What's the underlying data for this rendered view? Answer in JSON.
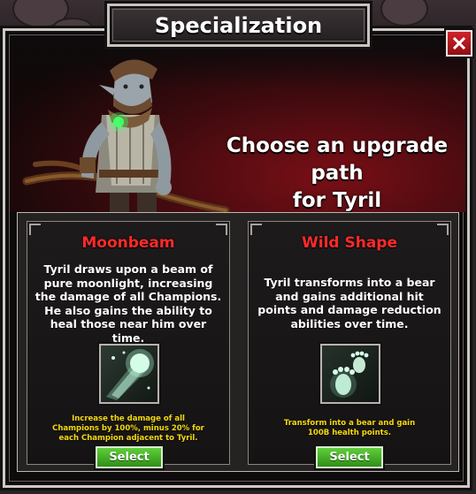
{
  "dialog": {
    "title": "Specialization",
    "close_symbol": "✕",
    "prompt_line1": "Choose an upgrade path",
    "prompt_line2": "for Tyril"
  },
  "options": [
    {
      "title": "Moonbeam",
      "description": "Tyril draws upon a beam of pure moonlight, increasing the damage of all Champions. He also gains the ability to heal those near him over time.",
      "icon": "moonbeam-icon",
      "effect_line1": "Increase the damage of all",
      "effect_line2": "Champions by 100%, minus 20% for",
      "effect_line3": "each Champion adjacent to Tyril.",
      "button_label": "Select"
    },
    {
      "title": "Wild Shape",
      "description": "Tyril transforms into a bear and gains additional hit points and damage reduction abilities over time.",
      "icon": "paw-prints-icon",
      "effect_line1": "Transform into a bear and gain",
      "effect_line2": "100B health points.",
      "button_label": "Select"
    }
  ],
  "colors": {
    "option_title": "#ff2a2a",
    "effect_text": "#f6d90f",
    "select_button": "#4cb52c",
    "close_button": "#c01a21"
  }
}
